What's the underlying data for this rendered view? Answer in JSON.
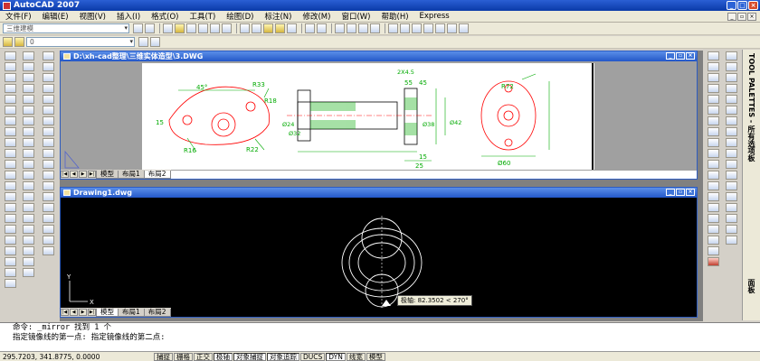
{
  "app": {
    "title": "AutoCAD 2007"
  },
  "menu": [
    "文件(F)",
    "编辑(E)",
    "视图(V)",
    "插入(I)",
    "格式(O)",
    "工具(T)",
    "绘图(D)",
    "标注(N)",
    "修改(M)",
    "窗口(W)",
    "帮助(H)",
    "Express"
  ],
  "toolbar": {
    "workspace": "三维建模",
    "layer": "0"
  },
  "palette": {
    "label": "TOOL PALETTES - 所有选项板",
    "label2": "面板"
  },
  "doc1": {
    "title": "D:\\xh-cad整理\\三维实体造型\\3.DWG",
    "tabs": [
      "模型",
      "布局1",
      "布局2"
    ],
    "dims": [
      "45°",
      "R33",
      "R18",
      "R16",
      "R22",
      "15",
      "R72",
      "Ø60",
      "Ø42",
      "Ø24",
      "Ø32",
      "Ø38",
      "25",
      "15",
      "55",
      "45",
      "2X4.5"
    ]
  },
  "doc2": {
    "title": "Drawing1.dwg",
    "tabs": [
      "模型",
      "布局1",
      "布局2"
    ],
    "tooltip": "极轴: 82.3502 < 270°",
    "ucs_y": "Y",
    "ucs_x": "X"
  },
  "command": {
    "line1": "命令: _mirror 找到 1 个",
    "line2": "指定镜像线的第一点: 指定镜像线的第二点:"
  },
  "status": {
    "coords": "295.7203, 341.8775, 0.0000",
    "buttons": [
      "捕捉",
      "栅格",
      "正交",
      "极轴",
      "对象捕捉",
      "对象追踪",
      "DUCS",
      "DYN",
      "线宽",
      "模型"
    ]
  }
}
